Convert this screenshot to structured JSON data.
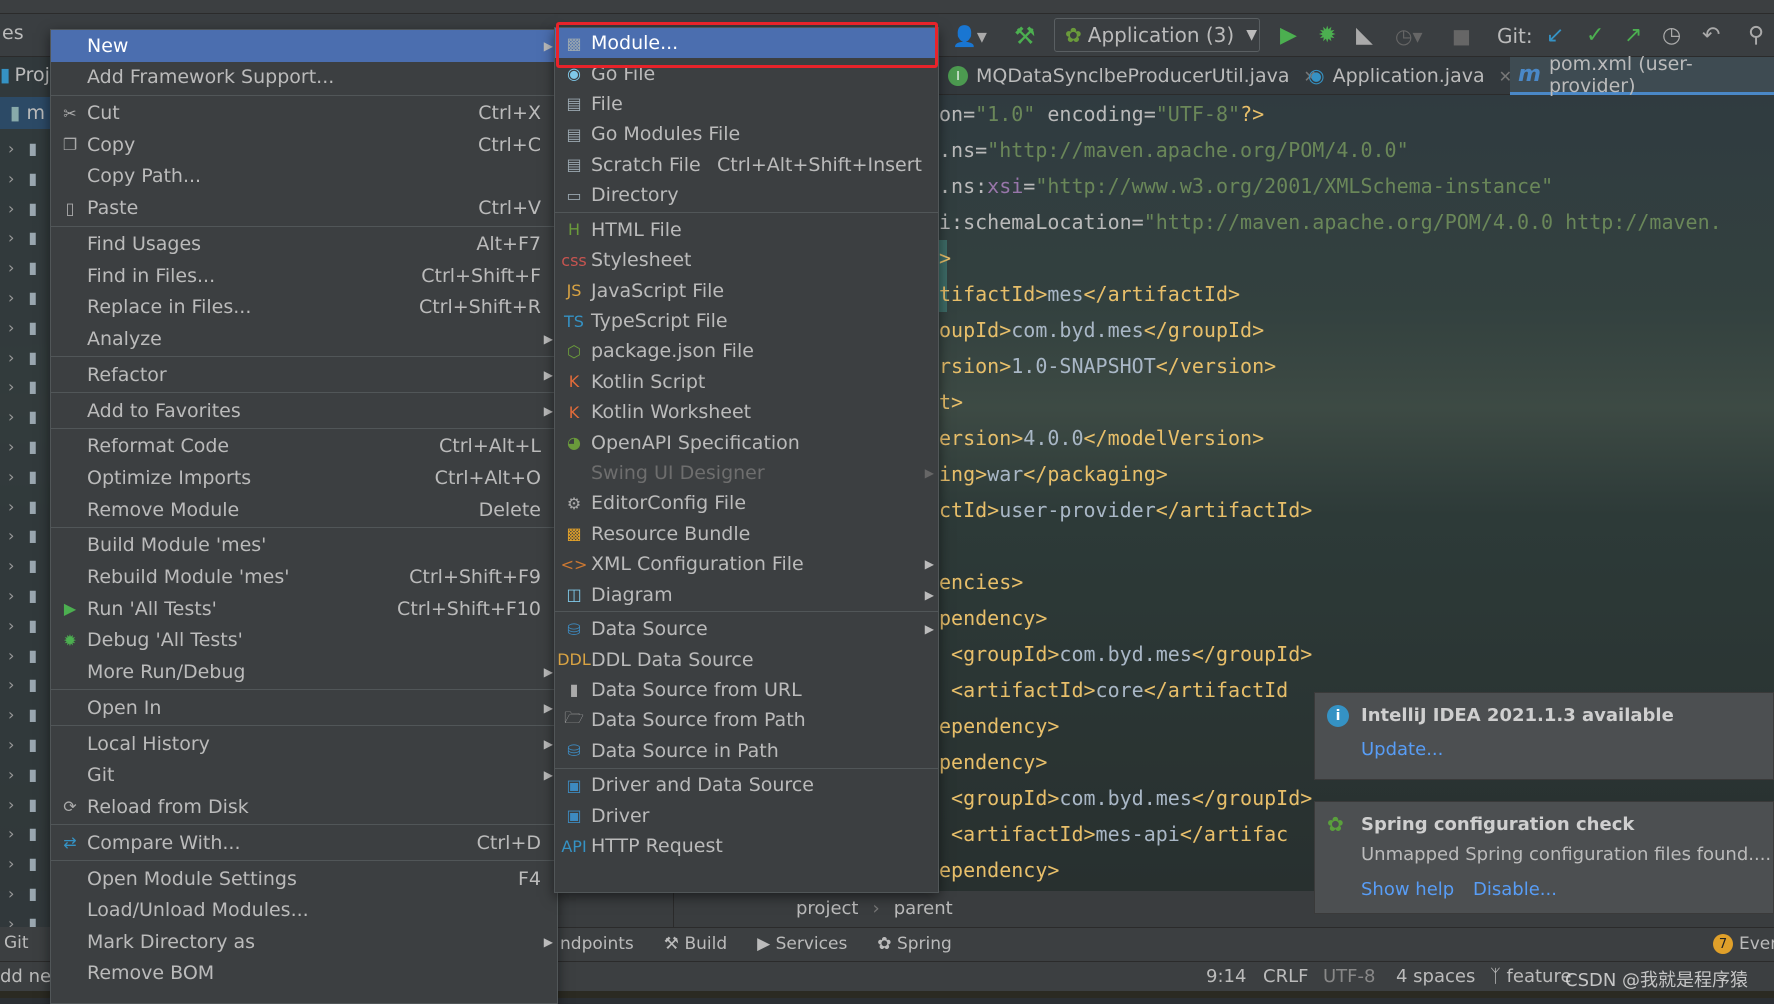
{
  "colors": {
    "menu_bg": "#3c3f41",
    "selected": "#4b6eaf",
    "highlight_box": "#e8232a",
    "link": "#589df6",
    "tag": "#e8bf6a",
    "string": "#6a8759"
  },
  "project_panel": {
    "header_label": "es",
    "tab_label": "Proj",
    "root_label": "m"
  },
  "toolbar": {
    "run_config": "Application (3)",
    "git_label": "Git:"
  },
  "tabs": [
    {
      "label": "MQDataSynclbeProducerUtil.java",
      "icon": "interface-icon",
      "active": false
    },
    {
      "label": "Application.java",
      "icon": "spring-class-icon",
      "active": false
    },
    {
      "label": "pom.xml (user-provider)",
      "icon": "maven-icon",
      "active": true
    }
  ],
  "context_menu": {
    "items": [
      {
        "label": "New",
        "icon": "",
        "shortcut": "",
        "arrow": true,
        "selected": true
      },
      {
        "label": "Add Framework Support...",
        "shortcut": ""
      },
      {
        "separator": true
      },
      {
        "label": "Cut",
        "icon": "scissors-icon",
        "shortcut": "Ctrl+X"
      },
      {
        "label": "Copy",
        "icon": "copy-icon",
        "shortcut": "Ctrl+C"
      },
      {
        "label": "Copy Path...",
        "shortcut": ""
      },
      {
        "label": "Paste",
        "icon": "clipboard-icon",
        "shortcut": "Ctrl+V"
      },
      {
        "separator": true
      },
      {
        "label": "Find Usages",
        "shortcut": "Alt+F7"
      },
      {
        "label": "Find in Files...",
        "shortcut": "Ctrl+Shift+F"
      },
      {
        "label": "Replace in Files...",
        "shortcut": "Ctrl+Shift+R"
      },
      {
        "label": "Analyze",
        "arrow": true
      },
      {
        "separator": true
      },
      {
        "label": "Refactor",
        "arrow": true
      },
      {
        "separator": true
      },
      {
        "label": "Add to Favorites",
        "arrow": true
      },
      {
        "separator": true
      },
      {
        "label": "Reformat Code",
        "shortcut": "Ctrl+Alt+L"
      },
      {
        "label": "Optimize Imports",
        "shortcut": "Ctrl+Alt+O"
      },
      {
        "label": "Remove Module",
        "shortcut": "Delete"
      },
      {
        "separator": true
      },
      {
        "label": "Build Module 'mes'",
        "shortcut": ""
      },
      {
        "label": "Rebuild Module 'mes'",
        "shortcut": "Ctrl+Shift+F9"
      },
      {
        "label": "Run 'All Tests'",
        "icon": "run-icon",
        "shortcut": "Ctrl+Shift+F10"
      },
      {
        "label": "Debug 'All Tests'",
        "icon": "debug-icon",
        "shortcut": ""
      },
      {
        "label": "More Run/Debug",
        "arrow": true
      },
      {
        "separator": true
      },
      {
        "label": "Open In",
        "arrow": true
      },
      {
        "separator": true
      },
      {
        "label": "Local History",
        "arrow": true
      },
      {
        "label": "Git",
        "arrow": true
      },
      {
        "label": "Reload from Disk",
        "icon": "reload-icon"
      },
      {
        "separator": true
      },
      {
        "label": "Compare With...",
        "icon": "compare-icon",
        "shortcut": "Ctrl+D"
      },
      {
        "separator": true
      },
      {
        "label": "Open Module Settings",
        "shortcut": "F4"
      },
      {
        "label": "Load/Unload Modules..."
      },
      {
        "label": "Mark Directory as",
        "arrow": true
      },
      {
        "label": "Remove BOM"
      }
    ]
  },
  "new_submenu": {
    "items": [
      {
        "label": "Module...",
        "icon": "module-icon",
        "selected": true
      },
      {
        "label": "Go File",
        "icon": "go-file-icon"
      },
      {
        "label": "File",
        "icon": "file-icon"
      },
      {
        "label": "Go Modules File",
        "icon": "file-icon"
      },
      {
        "label": "Scratch File",
        "icon": "scratch-file-icon",
        "shortcut": "Ctrl+Alt+Shift+Insert"
      },
      {
        "label": "Directory",
        "icon": "folder-icon"
      },
      {
        "separator": true
      },
      {
        "label": "HTML File",
        "icon": "html-file-icon"
      },
      {
        "label": "Stylesheet",
        "icon": "css-file-icon"
      },
      {
        "label": "JavaScript File",
        "icon": "js-file-icon"
      },
      {
        "label": "TypeScript File",
        "icon": "ts-file-icon"
      },
      {
        "label": "package.json File",
        "icon": "nodejs-icon"
      },
      {
        "label": "Kotlin Script",
        "icon": "kotlin-icon"
      },
      {
        "label": "Kotlin Worksheet",
        "icon": "kotlin-icon"
      },
      {
        "label": "OpenAPI Specification",
        "icon": "openapi-icon"
      },
      {
        "label": "Swing UI Designer",
        "disabled": true,
        "arrow": true
      },
      {
        "label": "EditorConfig File",
        "icon": "gear-icon"
      },
      {
        "label": "Resource Bundle",
        "icon": "resource-bundle-icon"
      },
      {
        "label": "XML Configuration File",
        "icon": "xml-file-icon",
        "arrow": true
      },
      {
        "label": "Diagram",
        "icon": "diagram-icon",
        "arrow": true
      },
      {
        "separator": true
      },
      {
        "label": "Data Source",
        "icon": "database-icon",
        "arrow": true
      },
      {
        "label": "DDL Data Source",
        "icon": "ddl-icon"
      },
      {
        "label": "Data Source from URL",
        "icon": "plug-icon"
      },
      {
        "label": "Data Source from Path",
        "icon": "open-folder-icon"
      },
      {
        "label": "Data Source in Path",
        "icon": "database-icon"
      },
      {
        "separator": true
      },
      {
        "label": "Driver and Data Source",
        "icon": "driver-icon"
      },
      {
        "label": "Driver",
        "icon": "driver-icon"
      },
      {
        "label": "HTTP Request",
        "icon": "api-icon"
      }
    ]
  },
  "code_lines": [
    [
      [
        "attr",
        "on="
      ],
      [
        "str",
        "\"1.0\""
      ],
      [
        "attr",
        " encoding="
      ],
      [
        "str",
        "\"UTF-8\""
      ],
      [
        "tag",
        "?>"
      ]
    ],
    [
      [
        "attr",
        ".ns="
      ],
      [
        "str",
        "\"http://maven.apache.org/POM/4.0.0\""
      ]
    ],
    [
      [
        "attr",
        ".ns:"
      ],
      [
        "ns",
        "xsi"
      ],
      [
        "attr",
        "="
      ],
      [
        "str",
        "\"http://www.w3.org/2001/XMLSchema-instance\""
      ]
    ],
    [
      [
        "attr",
        "i:schemaLocation="
      ],
      [
        "str",
        "\"http://maven.apache.org/POM/4.0.0 http://maven."
      ]
    ],
    [
      [
        "tag",
        ">"
      ]
    ],
    [
      [
        "tag",
        "tifactId>"
      ],
      [
        "text",
        "mes"
      ],
      [
        "tag",
        "</artifactId>"
      ]
    ],
    [
      [
        "tag",
        "oupId>"
      ],
      [
        "text",
        "com.byd.mes"
      ],
      [
        "tag",
        "</groupId>"
      ]
    ],
    [
      [
        "tag",
        "rsion>"
      ],
      [
        "text",
        "1.0-SNAPSHOT"
      ],
      [
        "tag",
        "</version>"
      ]
    ],
    [
      [
        "tag",
        "t>"
      ]
    ],
    [
      [
        "tag",
        "ersion>"
      ],
      [
        "text",
        "4.0.0"
      ],
      [
        "tag",
        "</modelVersion>"
      ]
    ],
    [
      [
        "tag",
        "ing>"
      ],
      [
        "text",
        "war"
      ],
      [
        "tag",
        "</packaging>"
      ]
    ],
    [
      [
        "tag",
        "ctId>"
      ],
      [
        "text",
        "user-provider"
      ],
      [
        "tag",
        "</artifactId>"
      ]
    ],
    [],
    [
      [
        "tag",
        "encies>"
      ]
    ],
    [
      [
        "tag",
        "pendency>"
      ]
    ],
    [
      [
        "tag",
        " <groupId>"
      ],
      [
        "text",
        "com.byd.mes"
      ],
      [
        "tag",
        "</groupId>"
      ]
    ],
    [
      [
        "tag",
        " <artifactId>"
      ],
      [
        "text",
        "core"
      ],
      [
        "tag",
        "</artifactId"
      ]
    ],
    [
      [
        "tag",
        "ependency>"
      ]
    ],
    [
      [
        "tag",
        "pendency>"
      ]
    ],
    [
      [
        "tag",
        " <groupId>"
      ],
      [
        "text",
        "com.byd.mes"
      ],
      [
        "tag",
        "</groupId>"
      ]
    ],
    [
      [
        "tag",
        " <artifactId>"
      ],
      [
        "text",
        "mes-api"
      ],
      [
        "tag",
        "</artifac"
      ]
    ],
    [
      [
        "tag",
        "ependency>"
      ]
    ]
  ],
  "notifications": [
    {
      "title": "IntelliJ IDEA 2021.1.3 available",
      "links": [
        "Update..."
      ],
      "icon": "info-icon"
    },
    {
      "title": "Spring configuration check",
      "body": "Unmapped Spring configuration files found....",
      "links": [
        "Show help",
        "Disable..."
      ],
      "icon": "spring-leaf-icon"
    }
  ],
  "breadcrumb": [
    "project",
    "parent"
  ],
  "tool_windows": {
    "left": "Git",
    "items": [
      "ndpoints",
      "Build",
      "Services",
      "Spring"
    ],
    "event_log": "Even",
    "event_count": "7"
  },
  "status_bar": {
    "left": "dd nev",
    "position": "9:14",
    "line_sep": "CRLF",
    "encoding": "UTF-8",
    "indent": "4 spaces",
    "branch": "feature",
    "watermark": "CSDN @我就是程序猿"
  }
}
